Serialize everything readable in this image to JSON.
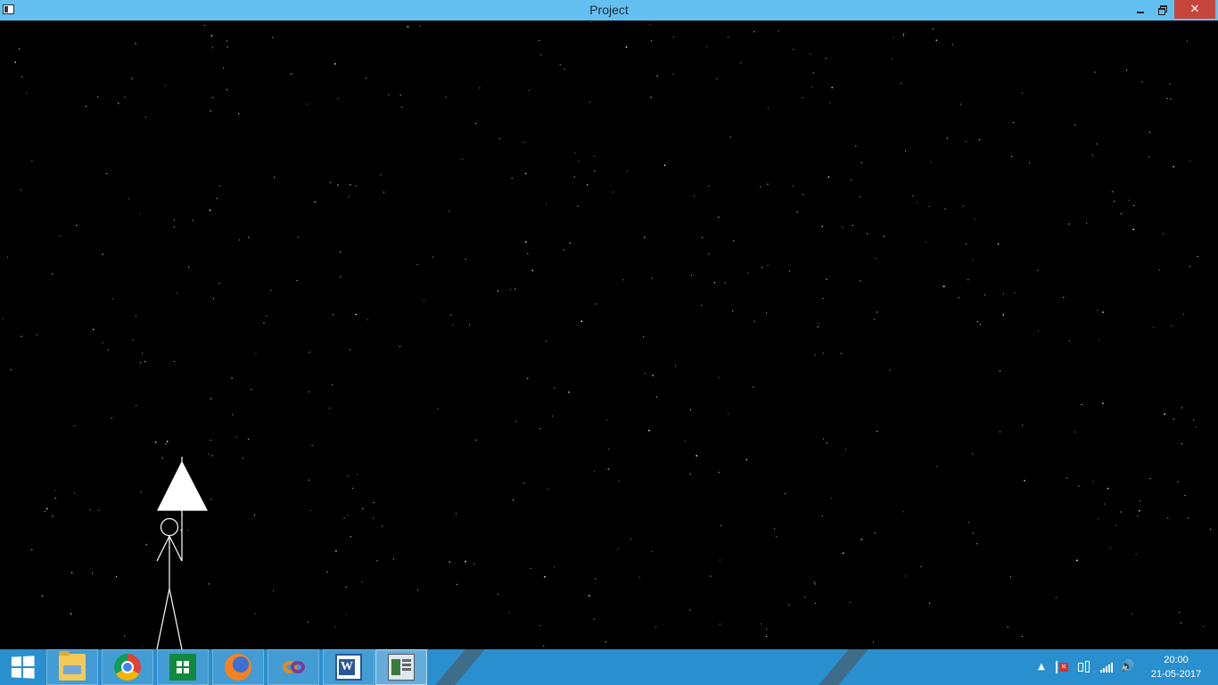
{
  "window": {
    "title": "Project",
    "minimize_icon": "minimize-icon",
    "restore_icon": "restore-icon",
    "close_glyph": "✕"
  },
  "taskbar": {
    "apps": [
      {
        "name": "file-explorer",
        "icon": "folder-icon"
      },
      {
        "name": "google-chrome",
        "icon": "chrome-icon"
      },
      {
        "name": "windows-store",
        "icon": "store-icon"
      },
      {
        "name": "firefox",
        "icon": "firefox-icon"
      },
      {
        "name": "visual-studio",
        "icon": "visual-studio-icon"
      },
      {
        "name": "microsoft-word",
        "icon": "word-icon",
        "glyph": "W"
      },
      {
        "name": "project-app",
        "icon": "project-window-icon",
        "active": true
      }
    ],
    "tray": {
      "up_arrow": "▲",
      "volume_glyph": "🔊"
    },
    "clock": {
      "time": "20:00",
      "date": "21-05-2017"
    }
  },
  "colors": {
    "titlebar": "#63c0f0",
    "close_button": "#c7463b",
    "taskbar": "#2a8fce",
    "canvas_background": "#000000",
    "stars": "#ffffff"
  }
}
